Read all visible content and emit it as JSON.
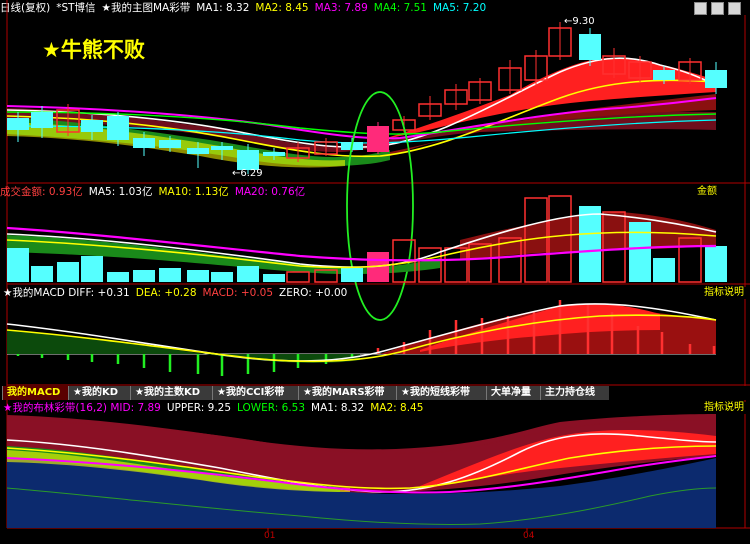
{
  "header": {
    "period": "日线(复权)",
    "stock": "*ST博信",
    "indicator": "★我的主图MA彩带",
    "ma": [
      {
        "label": "MA1: 8.32",
        "color": "#ffffff"
      },
      {
        "label": "MA2: 8.45",
        "color": "#ffff00"
      },
      {
        "label": "MA3: 7.89",
        "color": "#ff00ff"
      },
      {
        "label": "MA4: 7.51",
        "color": "#00ff00"
      },
      {
        "label": "MA5: 7.20",
        "color": "#00ffff"
      }
    ]
  },
  "annotations": {
    "overlay_text": "★牛熊不败",
    "high_price": "9.30",
    "low_price": "6.29"
  },
  "volume_panel": {
    "labels": [
      {
        "label": "成交金额: 0.93亿",
        "color": "#ff4040"
      },
      {
        "label": "MA5: 1.03亿",
        "color": "#ffffff"
      },
      {
        "label": "MA10: 1.13亿",
        "color": "#ffff00"
      },
      {
        "label": "MA20: 0.76亿",
        "color": "#ff00ff"
      }
    ],
    "button": "金额"
  },
  "macd_panel": {
    "labels": [
      {
        "label": "★我的MACD DIFF: +0.31",
        "color": "#ffffff"
      },
      {
        "label": "DEA: +0.28",
        "color": "#ffff00"
      },
      {
        "label": "MACD: +0.05",
        "color": "#ff4040"
      },
      {
        "label": "ZERO: +0.00",
        "color": "#ffffff"
      }
    ],
    "button": "指标说明"
  },
  "tabs": [
    "我的MACD",
    "★我的KD",
    "★我的主数KD",
    "★我的CCI彩带",
    "★我的MARS彩带",
    "★我的短线彩带",
    "大单净量",
    "主力持仓线"
  ],
  "boll_panel": {
    "labels": [
      {
        "label": "★我的布林彩带(16,2) MID: 7.89",
        "color": "#ff00ff"
      },
      {
        "label": "UPPER: 9.25",
        "color": "#ffffff"
      },
      {
        "label": "LOWER: 6.53",
        "color": "#00ff00"
      },
      {
        "label": "MA1: 8.32",
        "color": "#ffffff"
      },
      {
        "label": "MA2: 8.45",
        "color": "#ffff00"
      }
    ],
    "button": "指标说明"
  },
  "x_axis": [
    "01",
    "04"
  ],
  "colors": {
    "up": "#ff3030",
    "down": "#55ffff",
    "border": "#b00000"
  }
}
